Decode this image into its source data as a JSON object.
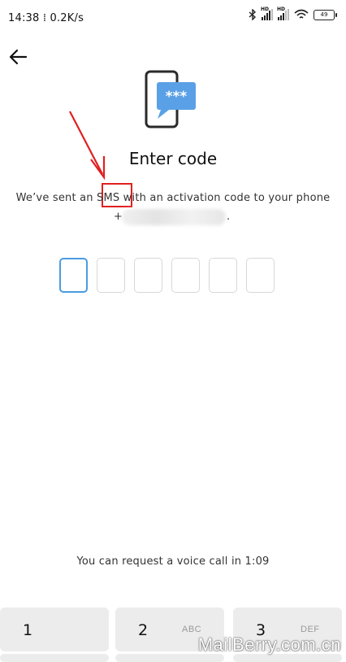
{
  "status": {
    "time": "14:38",
    "speed": "0.2K/s",
    "battery": "49",
    "hd1": "HD",
    "hd2": "HD"
  },
  "screen": {
    "title": "Enter code",
    "subtitle": "We’ve sent an SMS with an activation code to your phone",
    "phone_prefix": "+",
    "phone_suffix": ".",
    "code_boxes": 6,
    "voice_hint": "You can request a voice call in 1:09"
  },
  "keypad": [
    {
      "num": "1",
      "letters": ""
    },
    {
      "num": "2",
      "letters": "ABC"
    },
    {
      "num": "3",
      "letters": "DEF"
    }
  ],
  "watermark": "MailBerry.com.cn",
  "colors": {
    "accent": "#4a9be0",
    "annotation": "#e02020",
    "bubble": "#5aa0e6"
  }
}
